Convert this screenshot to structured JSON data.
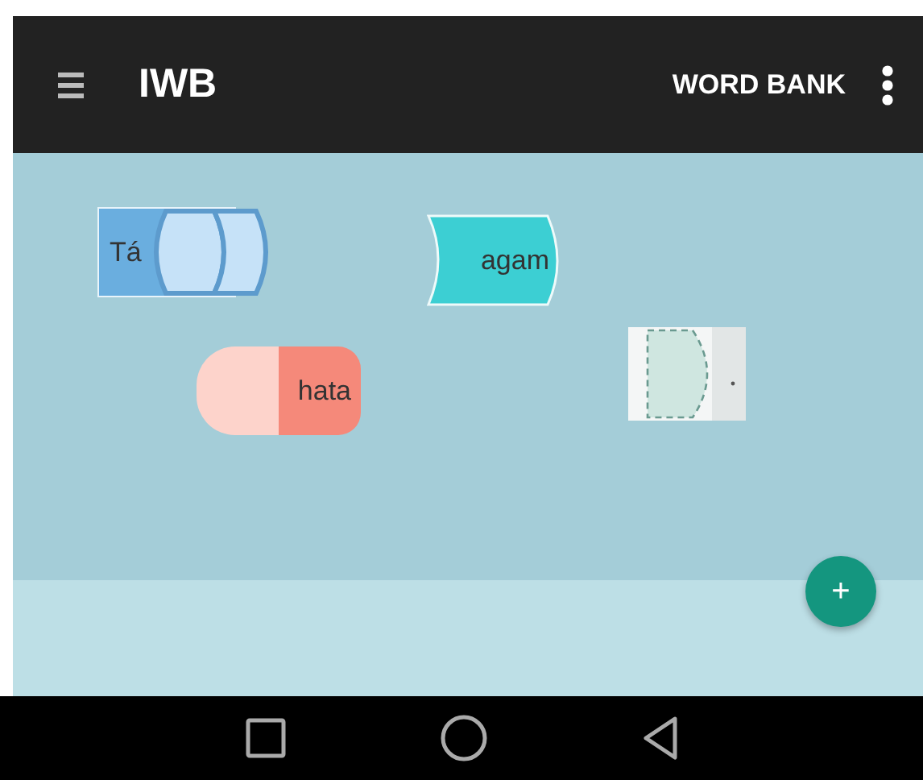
{
  "app_bar": {
    "title": "IWB",
    "action": "WORD BANK"
  },
  "pieces": [
    {
      "kind": "starter",
      "label": "Tá",
      "color": "#6aaedf"
    },
    {
      "kind": "word",
      "label": "agam",
      "color": "#3ccfd3"
    },
    {
      "kind": "word",
      "label": "hata",
      "color": "#f5897a"
    },
    {
      "kind": "slot"
    }
  ],
  "fab": {
    "label": "+"
  }
}
